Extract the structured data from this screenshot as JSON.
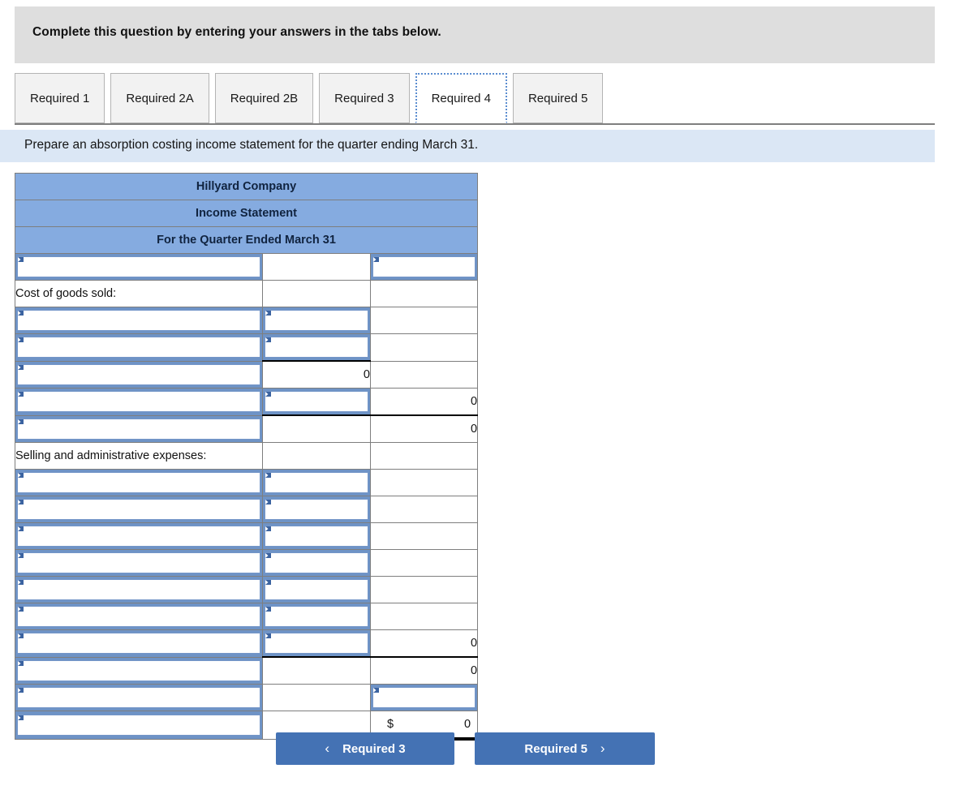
{
  "banner": {
    "text": "Complete this question by entering your answers in the tabs below."
  },
  "tabs": [
    {
      "label": "Required 1",
      "active": false
    },
    {
      "label": "Required 2A",
      "active": false
    },
    {
      "label": "Required 2B",
      "active": false
    },
    {
      "label": "Required 3",
      "active": false
    },
    {
      "label": "Required 4",
      "active": true
    },
    {
      "label": "Required 5",
      "active": false
    }
  ],
  "instruction": {
    "text": "Prepare an absorption costing income statement for the quarter ending March 31."
  },
  "statement": {
    "header_rows": [
      "Hillyard Company",
      "Income Statement",
      "For the Quarter Ended March 31"
    ],
    "rows": [
      {
        "c1": {
          "type": "dropdown",
          "value": ""
        },
        "c2": {
          "type": "blank"
        },
        "c3": {
          "type": "dropdown",
          "value": ""
        }
      },
      {
        "c1": {
          "type": "label",
          "value": "Cost of goods sold:"
        },
        "c2": {
          "type": "blank"
        },
        "c3": {
          "type": "blank"
        }
      },
      {
        "c1": {
          "type": "dropdown",
          "value": ""
        },
        "c2": {
          "type": "dropdown",
          "value": ""
        },
        "c3": {
          "type": "blank"
        }
      },
      {
        "c1": {
          "type": "dropdown",
          "value": ""
        },
        "c2": {
          "type": "dropdown",
          "value": ""
        },
        "c3": {
          "type": "blank"
        }
      },
      {
        "c1": {
          "type": "dropdown",
          "value": ""
        },
        "c2": {
          "type": "number",
          "value": "0",
          "rule": "top"
        },
        "c3": {
          "type": "blank"
        }
      },
      {
        "c1": {
          "type": "dropdown",
          "value": ""
        },
        "c2": {
          "type": "dropdown",
          "value": ""
        },
        "c3": {
          "type": "number",
          "value": "0"
        }
      },
      {
        "c1": {
          "type": "dropdown",
          "value": ""
        },
        "c2": {
          "type": "blank",
          "rule": "top"
        },
        "c3": {
          "type": "number",
          "value": "0",
          "rule": "top"
        }
      },
      {
        "c1": {
          "type": "label",
          "value": "Selling and administrative expenses:"
        },
        "c2": {
          "type": "blank"
        },
        "c3": {
          "type": "blank"
        }
      },
      {
        "c1": {
          "type": "dropdown",
          "value": ""
        },
        "c2": {
          "type": "dropdown",
          "value": ""
        },
        "c3": {
          "type": "blank"
        }
      },
      {
        "c1": {
          "type": "dropdown",
          "value": ""
        },
        "c2": {
          "type": "dropdown",
          "value": ""
        },
        "c3": {
          "type": "blank"
        }
      },
      {
        "c1": {
          "type": "dropdown",
          "value": ""
        },
        "c2": {
          "type": "dropdown",
          "value": ""
        },
        "c3": {
          "type": "blank"
        }
      },
      {
        "c1": {
          "type": "dropdown",
          "value": ""
        },
        "c2": {
          "type": "dropdown",
          "value": ""
        },
        "c3": {
          "type": "blank"
        }
      },
      {
        "c1": {
          "type": "dropdown",
          "value": ""
        },
        "c2": {
          "type": "dropdown",
          "value": ""
        },
        "c3": {
          "type": "blank"
        }
      },
      {
        "c1": {
          "type": "dropdown",
          "value": ""
        },
        "c2": {
          "type": "dropdown",
          "value": ""
        },
        "c3": {
          "type": "blank"
        }
      },
      {
        "c1": {
          "type": "dropdown",
          "value": ""
        },
        "c2": {
          "type": "dropdown",
          "value": ""
        },
        "c3": {
          "type": "number",
          "value": "0"
        }
      },
      {
        "c1": {
          "type": "dropdown",
          "value": ""
        },
        "c2": {
          "type": "blank",
          "rule": "top"
        },
        "c3": {
          "type": "number",
          "value": "0",
          "rule": "top"
        }
      },
      {
        "c1": {
          "type": "dropdown",
          "value": ""
        },
        "c2": {
          "type": "blank"
        },
        "c3": {
          "type": "dropdown",
          "value": ""
        }
      },
      {
        "c1": {
          "type": "dropdown",
          "value": ""
        },
        "c2": {
          "type": "blank"
        },
        "c3": {
          "type": "number",
          "value": "0",
          "symbol": "$",
          "rule": "grand"
        }
      }
    ]
  },
  "nav": {
    "prev_label": "Required 3",
    "next_label": "Required 5",
    "prev_chevron": "‹",
    "next_chevron": "›"
  },
  "colors": {
    "banner_gray": "#dedede",
    "header_blue": "#85abe0",
    "instruction_blue": "#dbe7f5",
    "button_blue": "#4472b4",
    "dropdown_border": "#7496c8"
  }
}
